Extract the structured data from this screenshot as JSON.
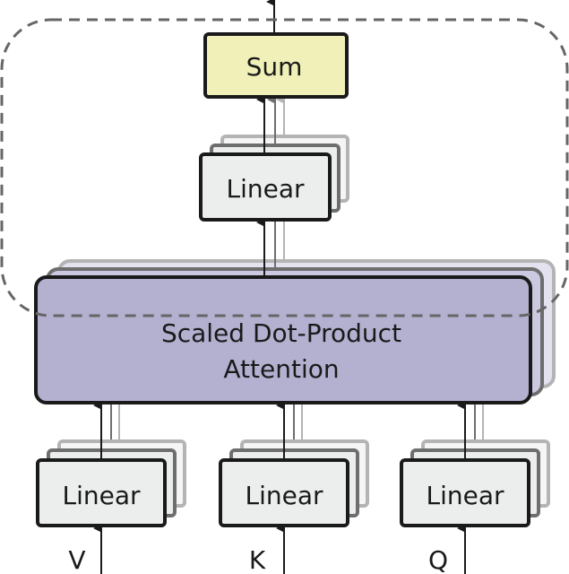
{
  "nodes": {
    "sum": {
      "label": "Sum",
      "fill": "#f0f0b8"
    },
    "linear_out": {
      "label": "Linear",
      "fill": "#eceeed"
    },
    "attention": {
      "line1": "Scaled Dot-Product",
      "line2": "Attention",
      "fill": "#b3b0d0"
    },
    "linear_v": {
      "label": "Linear",
      "fill": "#eceeed"
    },
    "linear_k": {
      "label": "Linear",
      "fill": "#eceeed"
    },
    "linear_q": {
      "label": "Linear",
      "fill": "#eceeed"
    }
  },
  "inputs": {
    "v": "V",
    "k": "K",
    "q": "Q"
  },
  "colors": {
    "stroke": "#1a1a1a",
    "dashed_border": "#666666",
    "mid_grey": "#6e6e6e",
    "light_grey": "#b4b4b4"
  }
}
